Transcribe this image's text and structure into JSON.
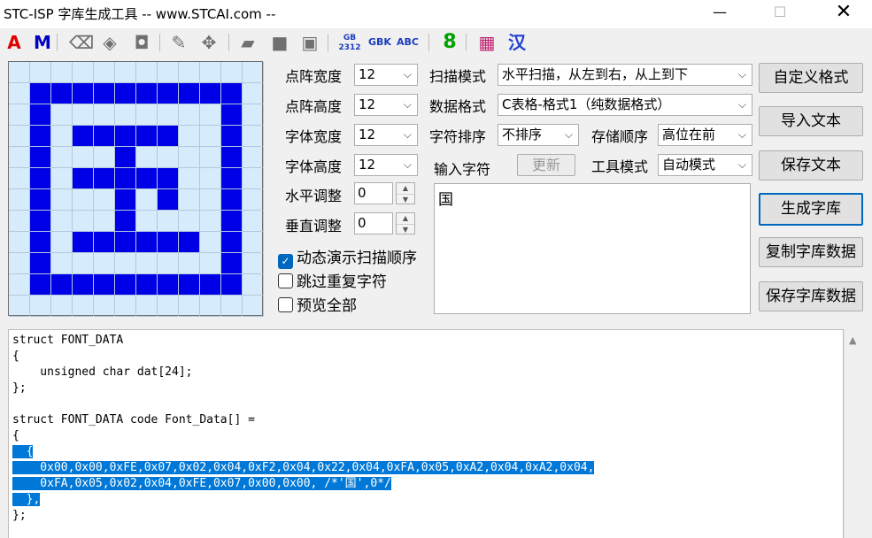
{
  "window": {
    "title": "STC-ISP 字库生成工具 -- www.STCAI.com --",
    "min": "—",
    "max": "☐",
    "close": "✕"
  },
  "toolbar": [
    {
      "name": "font-a-icon",
      "glyph": "A",
      "color": "#e00000"
    },
    {
      "name": "font-m-icon",
      "glyph": "M",
      "color": "#0000c0"
    },
    {
      "name": "eraser-icon",
      "glyph": "⌫",
      "color": "#707070"
    },
    {
      "name": "fill-icon",
      "glyph": "◈",
      "color": "#707070"
    },
    {
      "name": "stamp-icon",
      "glyph": "◘",
      "color": "#707070"
    },
    {
      "name": "pencil-icon",
      "glyph": "✎",
      "color": "#707070"
    },
    {
      "name": "move-icon",
      "glyph": "✥",
      "color": "#707070"
    },
    {
      "name": "open-icon",
      "glyph": "▰",
      "color": "#707070"
    },
    {
      "name": "save-icon",
      "glyph": "■",
      "color": "#707070"
    },
    {
      "name": "save-as-icon",
      "glyph": "▣",
      "color": "#707070"
    },
    {
      "name": "gb2312-icon",
      "glyph": "GB2312",
      "color": "#1a3cc0"
    },
    {
      "name": "gbk-icon",
      "glyph": "GBK",
      "color": "#1a3cc0"
    },
    {
      "name": "abc-icon",
      "glyph": "ABC",
      "color": "#1a3cc0"
    },
    {
      "name": "digit-8-icon",
      "glyph": "8",
      "color": "#00a000"
    },
    {
      "name": "palette-icon",
      "glyph": "▦",
      "color": "#c02070"
    },
    {
      "name": "chinese-icon",
      "glyph": "汉",
      "color": "#2040d0"
    }
  ],
  "matrix": {
    "width": 12,
    "height": 12,
    "rows": [
      "000000000000",
      "011111111110",
      "010000000010",
      "010111110010",
      "010001000010",
      "010111110010",
      "010001010010",
      "010001000010",
      "010111111010",
      "010000000010",
      "011111111110",
      "000000000000"
    ]
  },
  "form": {
    "dot_width_label": "点阵宽度",
    "dot_width": "12",
    "dot_height_label": "点阵高度",
    "dot_height": "12",
    "font_width_label": "字体宽度",
    "font_width": "12",
    "font_height_label": "字体高度",
    "font_height": "12",
    "h_adjust_label": "水平调整",
    "h_adjust": "0",
    "v_adjust_label": "垂直调整",
    "v_adjust": "0",
    "scan_mode_label": "扫描模式",
    "scan_mode": "水平扫描，从左到右，从上到下",
    "data_format_label": "数据格式",
    "data_format": "C表格-格式1（纯数据格式）",
    "char_sort_label": "字符排序",
    "char_sort": "不排序",
    "store_order_label": "存储顺序",
    "store_order": "高位在前",
    "input_chars_label": "输入字符",
    "refresh_label": "更新",
    "tool_mode_label": "工具模式",
    "tool_mode": "自动模式",
    "input_text": "国"
  },
  "checkboxes": [
    {
      "label": "动态演示扫描顺序",
      "checked": true
    },
    {
      "label": "跳过重复字符",
      "checked": false
    },
    {
      "label": "预览全部",
      "checked": false
    }
  ],
  "buttons": {
    "custom_format": "自定义格式",
    "import_text": "导入文本",
    "save_text": "保存文本",
    "generate": "生成字库",
    "copy_data": "复制字库数据",
    "save_data": "保存字库数据"
  },
  "code": {
    "lines": [
      "struct FONT_DATA",
      "{",
      "    unsigned char dat[24];",
      "};",
      "",
      "struct FONT_DATA code Font_Data[] =",
      "{"
    ],
    "highlighted": [
      "  {",
      "    0x00,0x00,0xFE,0x07,0x02,0x04,0xF2,0x04,0x22,0x04,0xFA,0x05,0xA2,0x04,0xA2,0x04,",
      "    0xFA,0x05,0x02,0x04,0xFE,0x07,0x00,0x00, /*'国',0*/",
      "  },"
    ],
    "tail": [
      "};"
    ]
  }
}
